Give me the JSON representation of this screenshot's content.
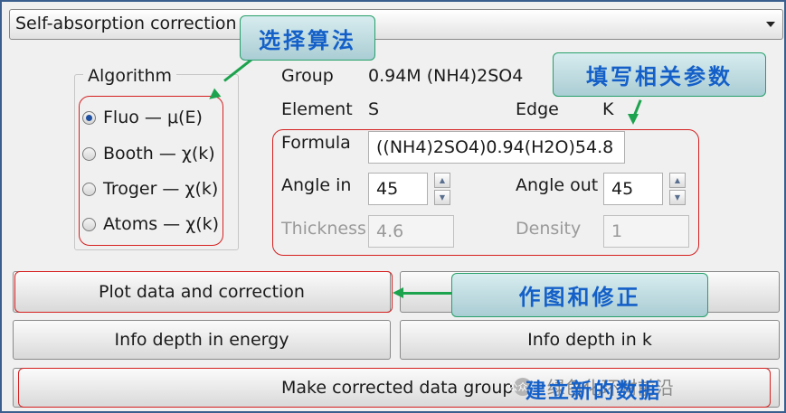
{
  "mode_select": {
    "value": "Self-absorption correction"
  },
  "algorithm": {
    "title": "Algorithm",
    "options": [
      {
        "label": "Fluo — μ(E)",
        "checked": true
      },
      {
        "label": "Booth — χ(k)",
        "checked": false
      },
      {
        "label": "Troger — χ(k)",
        "checked": false
      },
      {
        "label": "Atoms — χ(k)",
        "checked": false
      }
    ]
  },
  "info": {
    "group_label": "Group",
    "group_value": "0.94M (NH4)2SO4",
    "element_label": "Element",
    "element_value": "S",
    "edge_label": "Edge",
    "edge_value": "K"
  },
  "params": {
    "formula_label": "Formula",
    "formula_value": "((NH4)2SO4)0.94(H2O)54.8",
    "angle_in_label": "Angle in",
    "angle_in_value": "45",
    "angle_out_label": "Angle out",
    "angle_out_value": "45",
    "thickness_label": "Thickness",
    "thickness_value": "4.6",
    "density_label": "Density",
    "density_value": "1"
  },
  "buttons": {
    "plot": "Plot data and correction",
    "info_energy": "Info depth in energy",
    "info_k": "Info depth in k",
    "make_group": "Make corrected data group"
  },
  "annotations": {
    "algorithm_callout": "选择算法",
    "params_callout": "填写相关参数",
    "plot_callout": "作图和修正",
    "make_group_overlay": "建立新的数据"
  },
  "watermark": {
    "badge": "公众号",
    "text": "· 绿色化环材前沿"
  },
  "colors": {
    "frame_border": "#3a5f8f",
    "annotation_red": "#d62020",
    "annotation_green": "#1da34e",
    "annotation_blue_text": "#1460c8"
  }
}
